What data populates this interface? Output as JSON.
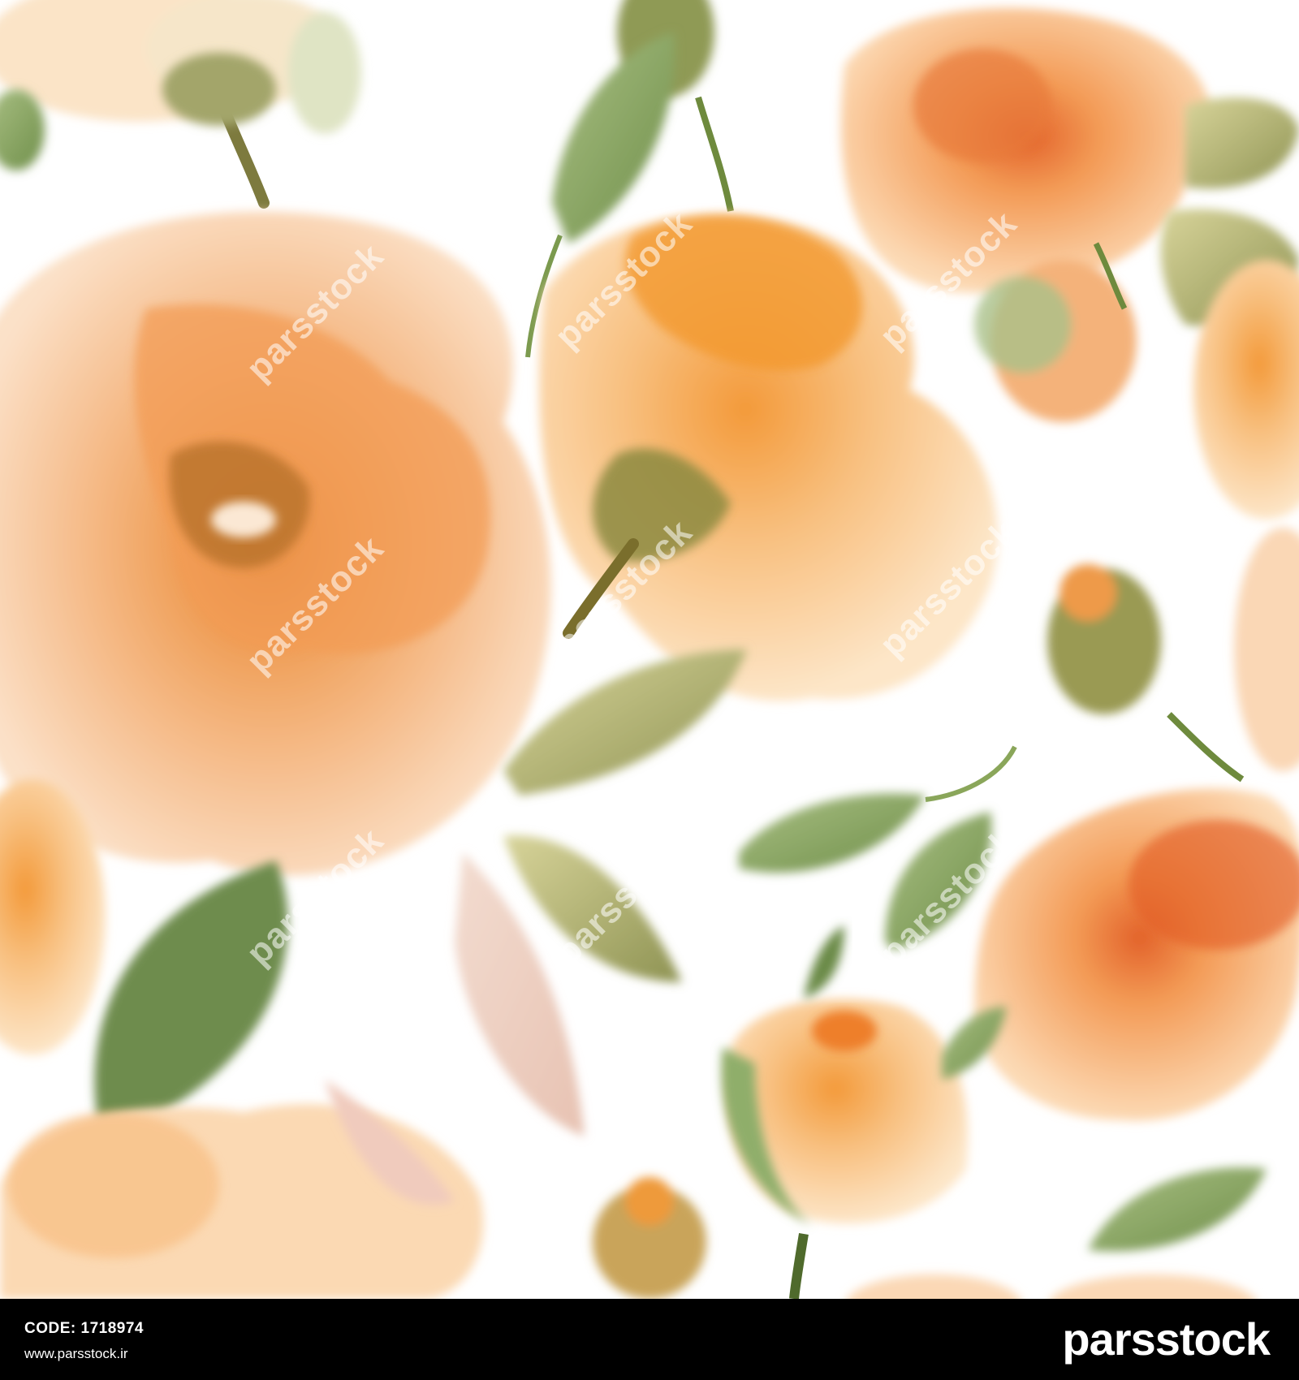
{
  "image": {
    "description_colors": {
      "petal_light": "#f9d7b1",
      "petal_mid": "#f6b77a",
      "petal_deep": "#ee8a3a",
      "leaf_green": "#8da866",
      "leaf_olive": "#9c9a55",
      "stem_dark": "#6b7a3a"
    }
  },
  "watermark": {
    "text": "parsstock"
  },
  "footer": {
    "code_label": "CODE: 1718974",
    "website": "www.parsstock.ir",
    "brand": "parsstock",
    "background": "#000000",
    "text_color": "#ffffff"
  }
}
